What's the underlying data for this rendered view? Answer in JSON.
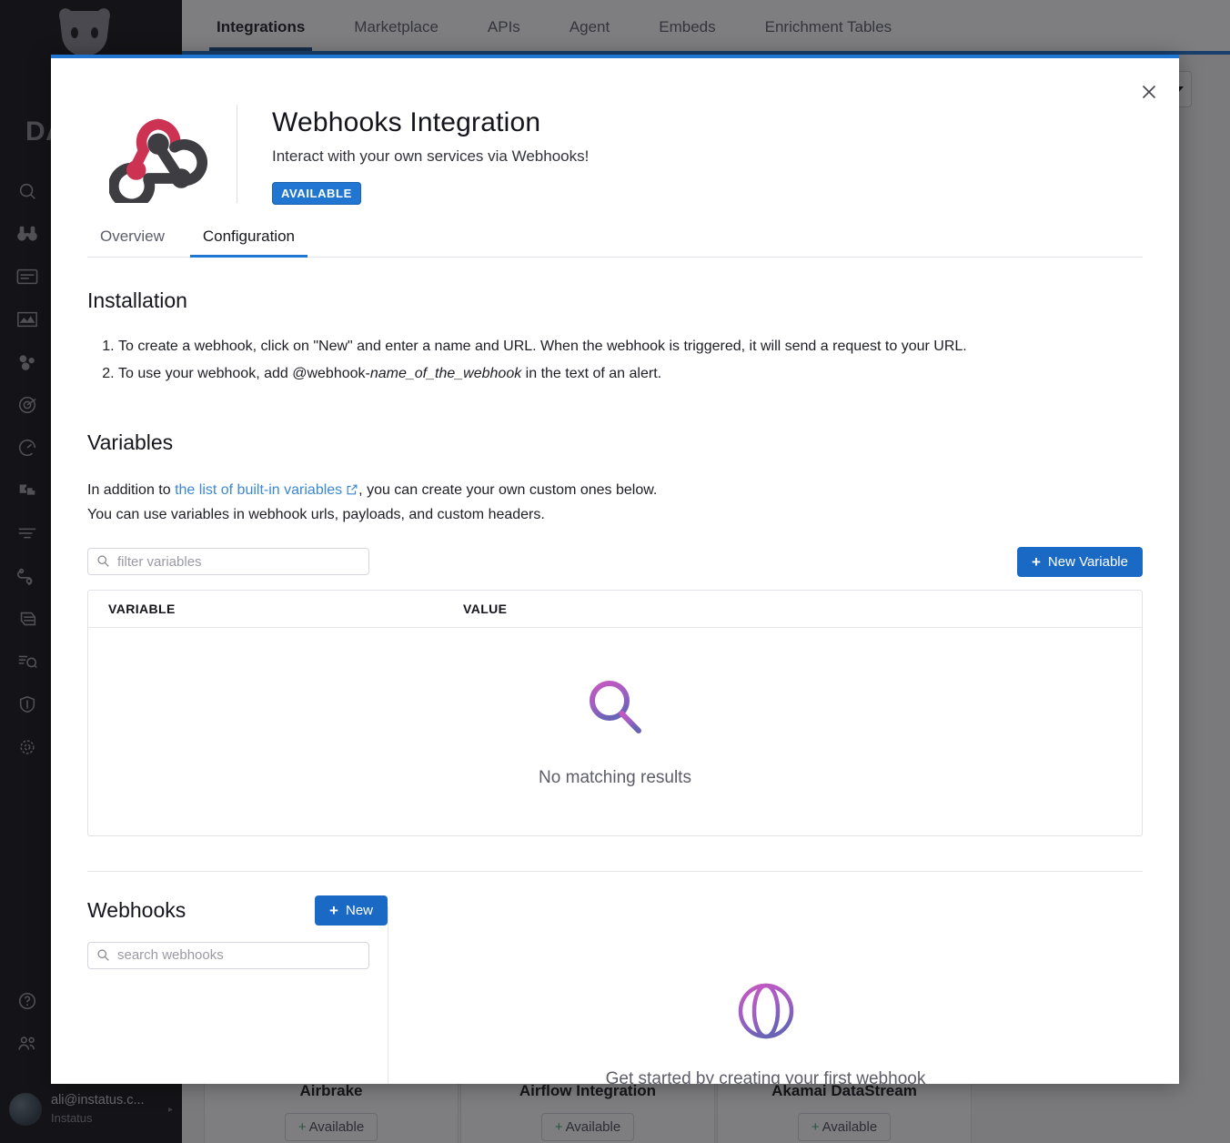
{
  "background": {
    "product_wordmark": "DA",
    "logo_icon": "datadog-dog-logo",
    "nav_tabs": [
      {
        "label": "Integrations",
        "active": true
      },
      {
        "label": "Marketplace",
        "active": false
      },
      {
        "label": "APIs",
        "active": false
      },
      {
        "label": "Agent",
        "active": false
      },
      {
        "label": "Embeds",
        "active": false
      },
      {
        "label": "Enrichment Tables",
        "active": false
      }
    ],
    "sidebar_icons": [
      "search-icon",
      "watchdog-binoculars-icon",
      "dashboards-icon",
      "notebooks-chart-icon",
      "infrastructure-icon",
      "apm-target-icon",
      "digital-experience-gauge-icon",
      "service-catalog-puzzle-icon",
      "logs-list-icon",
      "workflows-link-icon",
      "database-icon",
      "ci-visibility-icon",
      "security-shield-icon",
      "settings-gear-icon"
    ],
    "sidebar_bottom_icons": [
      "help-question-icon",
      "team-people-icon"
    ],
    "user": {
      "email": "ali@instatus.c...",
      "org": "Instatus",
      "avatar": "user-avatar"
    },
    "cards": [
      {
        "title": "Airbrake",
        "action": "Available",
        "plus": "+"
      },
      {
        "title": "Airflow Integration",
        "action": "Available",
        "plus": "+"
      },
      {
        "title": "Akamai DataStream",
        "action": "Available",
        "plus": "+"
      }
    ],
    "colors": {
      "accent": "#2176d2",
      "sidebar_bg": "#16161a",
      "available_green": "#3aa76d"
    }
  },
  "modal": {
    "close_label": "×",
    "logo_icon": "webhooks-logo",
    "title": "Webhooks Integration",
    "subtitle": "Interact with your own services via Webhooks!",
    "badge": "AVAILABLE",
    "tabs": [
      {
        "label": "Overview",
        "active": false
      },
      {
        "label": "Configuration",
        "active": true
      }
    ],
    "installation": {
      "heading": "Installation",
      "steps": [
        {
          "pre": "To create a webhook, click on \"New\" and enter a name and URL. When the webhook is triggered, it will send a request to your URL.",
          "em": "",
          "post": ""
        },
        {
          "pre": "To use your webhook, add @webhook-",
          "em": "name_of_the_webhook",
          "post": " in the text of an alert."
        }
      ]
    },
    "variables": {
      "heading": "Variables",
      "desc_pre": "In addition to ",
      "desc_link": "the list of built-in variables",
      "desc_post": ", you can create your own custom ones below.",
      "desc_line2": "You can use variables in webhook urls, payloads, and custom headers.",
      "filter_placeholder": "filter variables",
      "filter_value": "",
      "new_button": "New Variable",
      "new_button_plus": "+",
      "columns": [
        "VARIABLE",
        "VALUE"
      ],
      "rows": [],
      "empty_text": "No matching results",
      "empty_icon": "magnifier-empty-icon"
    },
    "webhooks": {
      "heading": "Webhooks",
      "new_button": "New",
      "new_button_plus": "+",
      "search_placeholder": "search webhooks",
      "search_value": "",
      "empty_text": "Get started by creating your first webhook",
      "empty_icon": "globe-empty-icon"
    },
    "colors": {
      "accent": "#2176d2",
      "button": "#1a69c4",
      "link": "#3b87d4"
    }
  }
}
